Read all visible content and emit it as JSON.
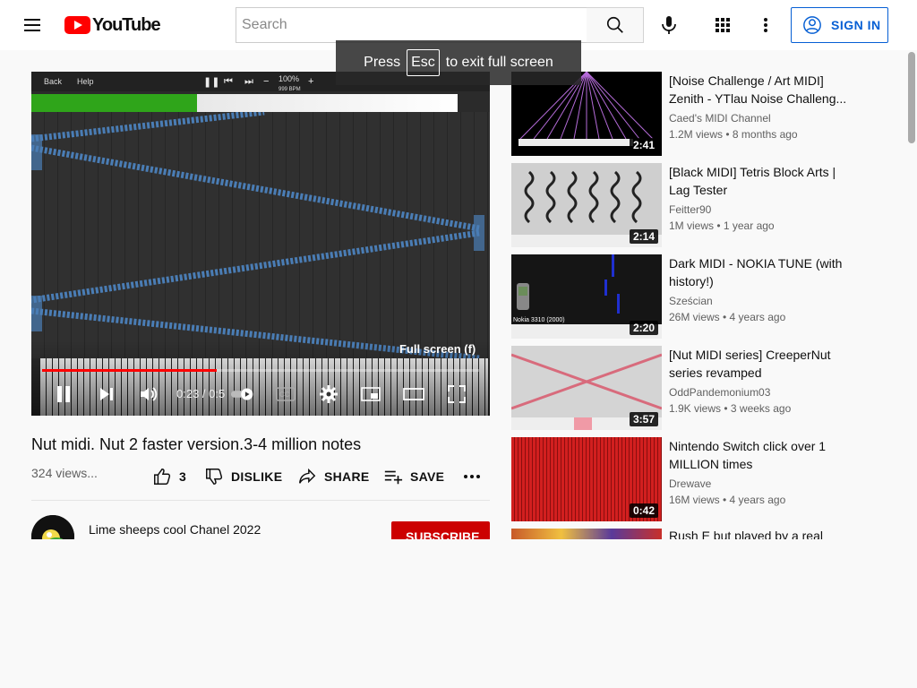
{
  "header": {
    "logo_text": "YouTube",
    "search_placeholder": "Search",
    "signin_label": "SIGN IN"
  },
  "toast": {
    "prefix": "Press",
    "key": "Esc",
    "suffix": "to exit full screen"
  },
  "player": {
    "midi_back": "Back",
    "midi_help": "Help",
    "midi_zoom": "100%",
    "midi_bpm": "999 BPM",
    "fullscreen_tooltip": "Full screen (f)",
    "time_display": "0:23 / 0:5",
    "progress_fraction": 0.4
  },
  "video": {
    "title": "Nut midi. Nut 2 faster version.3-4 million notes",
    "views": "324 views...",
    "like_count": "3",
    "dislike_label": "DISLIKE",
    "share_label": "SHARE",
    "save_label": "SAVE",
    "channel_name": "Lime sheeps cool Chanel 2022",
    "subscribe_label": "SUBSCRIBE"
  },
  "recommendations": [
    {
      "title": "[Noise Challenge / Art MIDI] Zenith - YTlau Noise Challeng...",
      "channel": "Caed's MIDI Channel",
      "meta": "1.2M views • 8 months ago",
      "duration": "2:41"
    },
    {
      "title": "[Black MIDI] Tetris Block Arts | Lag Tester",
      "channel": "Feitter90",
      "meta": "1M views • 1 year ago",
      "duration": "2:14"
    },
    {
      "title": "Dark MIDI - NOKIA TUNE (with history!)",
      "channel": "Sześcian",
      "meta": "26M views • 4 years ago",
      "duration": "2:20",
      "thumb_caption": "Nokia 3310 (2000)"
    },
    {
      "title": "[Nut MIDI series] CreeperNut series revamped",
      "channel": "OddPandemonium03",
      "meta": "1.9K views • 3 weeks ago",
      "duration": "3:57"
    },
    {
      "title": "Nintendo Switch click over 1 MILLION times",
      "channel": "Drewave",
      "meta": "16M views • 4 years ago",
      "duration": "0:42"
    },
    {
      "title": "Rush E but played by a real",
      "channel": "",
      "meta": "",
      "duration": ""
    }
  ],
  "colors": {
    "brand_red": "#ff0000",
    "signin_blue": "#065fd4",
    "subscribe_red": "#cc0000"
  }
}
